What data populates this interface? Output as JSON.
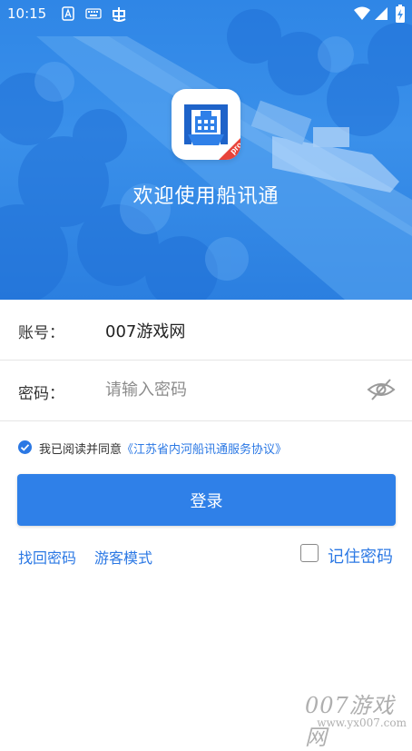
{
  "status_bar": {
    "time": "10:15",
    "left_icons": [
      "keyboard-a-icon",
      "keyboard-icon",
      "app-notification-icon"
    ],
    "right_icons": [
      "wifi-icon",
      "signal-icon",
      "battery-charging-icon"
    ]
  },
  "hero": {
    "welcome_text": "欢迎使用船讯通",
    "app_icon_badge": "pro"
  },
  "form": {
    "account_label": "账号：",
    "account_value": "007游戏网",
    "password_label": "密码：",
    "password_placeholder": "请输入密码",
    "password_toggle_icon": "eye-off-icon"
  },
  "agreement": {
    "checked": true,
    "text": "我已阅读并同意",
    "link_text": "《江苏省内河船讯通服务协议》"
  },
  "actions": {
    "login_label": "登录",
    "forgot_password": "找回密码",
    "guest_mode": "游客模式",
    "remember_label": "记住密码",
    "remember_checked": false
  },
  "watermark": {
    "title": "007游戏网",
    "url": "www.yx007.com"
  },
  "colors": {
    "primary": "#2f80e8",
    "link": "#2b78e4",
    "hero": "#3a90ea"
  }
}
